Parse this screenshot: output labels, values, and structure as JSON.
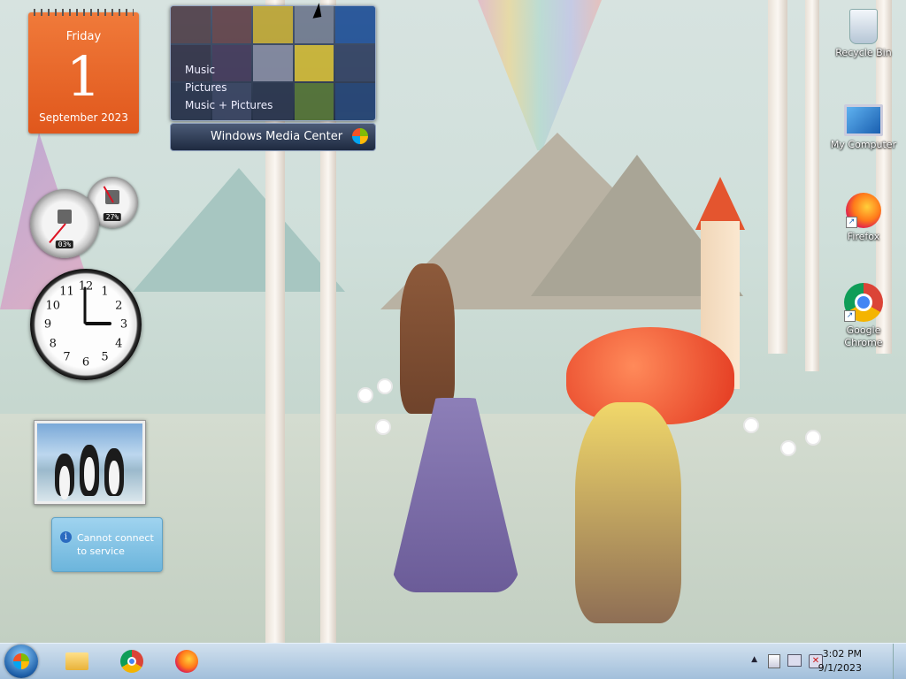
{
  "calendar": {
    "weekday": "Friday",
    "day": "1",
    "month_year": "September 2023"
  },
  "cpu_meter": {
    "big_pct": "03%",
    "small_pct": "27%"
  },
  "clock_gadget": {
    "numbers": [
      "12",
      "1",
      "2",
      "3",
      "4",
      "5",
      "6",
      "7",
      "8",
      "9",
      "10",
      "11"
    ]
  },
  "media_center": {
    "menu": [
      "Music",
      "Pictures",
      "Music + Pictures"
    ],
    "title": "Windows Media Center"
  },
  "weather": {
    "message": "Cannot connect to service",
    "icon": "info-icon"
  },
  "desktop_icons": [
    {
      "label": "Recycle Bin",
      "icon": "recycle-bin-icon"
    },
    {
      "label": "My Computer",
      "icon": "computer-icon"
    },
    {
      "label": "Firefox",
      "icon": "firefox-icon"
    },
    {
      "label": "Google Chrome",
      "icon": "chrome-icon"
    }
  ],
  "taskbar": {
    "start": "start-button",
    "pinned": [
      "file-explorer-icon",
      "chrome-icon",
      "firefox-icon"
    ],
    "tray": {
      "show_hidden": "▲",
      "time": "3:02 PM",
      "date": "9/1/2023"
    }
  }
}
